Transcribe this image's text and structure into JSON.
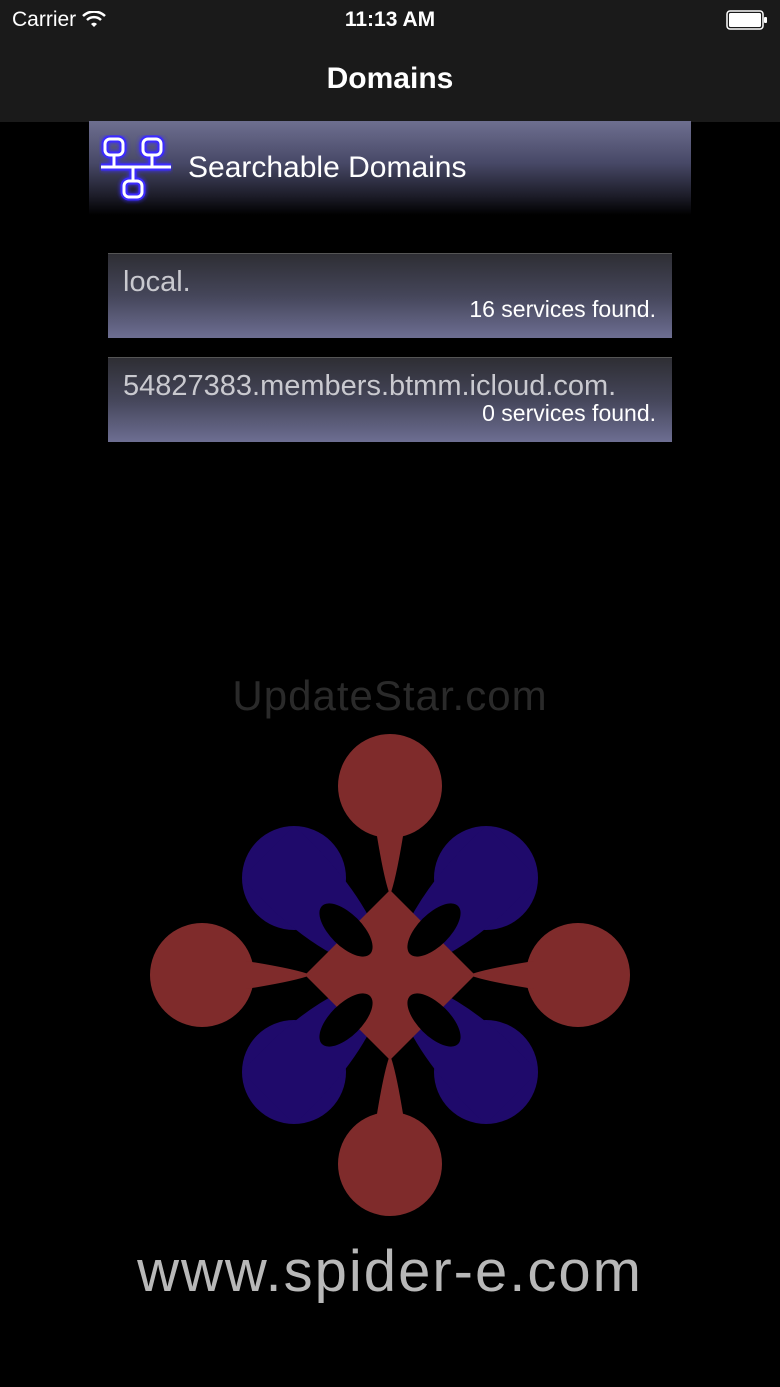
{
  "status_bar": {
    "carrier": "Carrier",
    "time": "11:13 AM",
    "icons": [
      "wifi-icon",
      "battery-icon"
    ]
  },
  "nav": {
    "title": "Domains"
  },
  "section": {
    "title": "Searchable Domains",
    "icon": "network-icon"
  },
  "domains": [
    {
      "name": "local.",
      "count": "16 services found."
    },
    {
      "name": "54827383.members.btmm.icloud.com.",
      "count": "0 services found."
    }
  ],
  "branding": {
    "watermark": "UpdateStar.com",
    "url": "www.spider-e.com",
    "logo_colors": {
      "petal_red": "#7f2b2b",
      "petal_blue": "#1f0a6b"
    }
  },
  "colors": {
    "background": "#000000",
    "bar": "#1a1a1a",
    "header_gradient_top": "#6e6f90",
    "row_gradient_bottom": "#6d6e92"
  }
}
